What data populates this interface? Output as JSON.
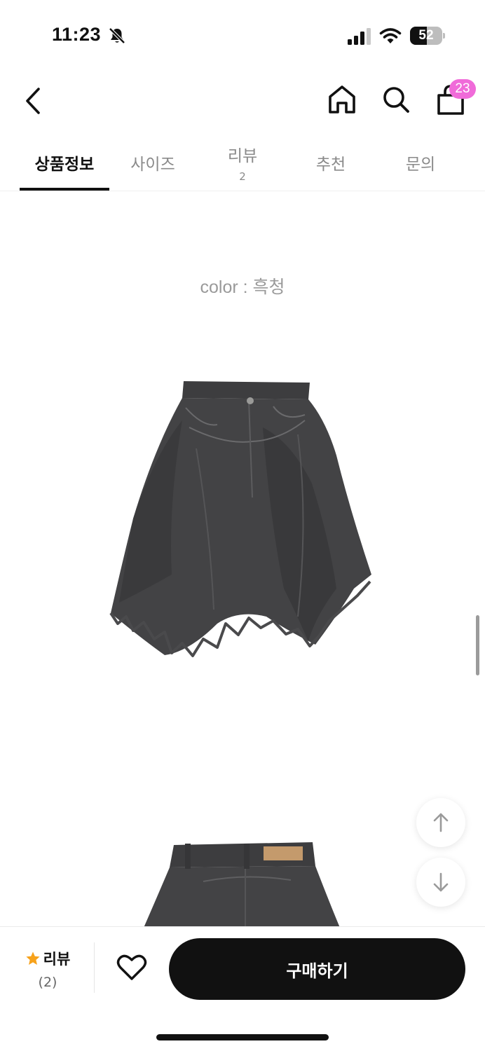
{
  "status_bar": {
    "time": "11:23",
    "battery_level": "52",
    "battery_fraction": 0.52
  },
  "header": {
    "cart_count": "23",
    "icons": [
      "back-icon",
      "home-icon",
      "search-icon",
      "shopping-bag-icon"
    ]
  },
  "tabs": [
    {
      "label": "상품정보",
      "active": true
    },
    {
      "label": "사이즈"
    },
    {
      "label": "리뷰",
      "count": "2"
    },
    {
      "label": "추천"
    },
    {
      "label": "문의"
    }
  ],
  "content": {
    "color_label": "color : 흑청"
  },
  "bottom_bar": {
    "review_label": "리뷰",
    "review_count": "(2)",
    "buy_label": "구매하기"
  },
  "colors": {
    "accent_badge": "#f06bd9",
    "star": "#f7a21b",
    "primary": "#111111"
  }
}
